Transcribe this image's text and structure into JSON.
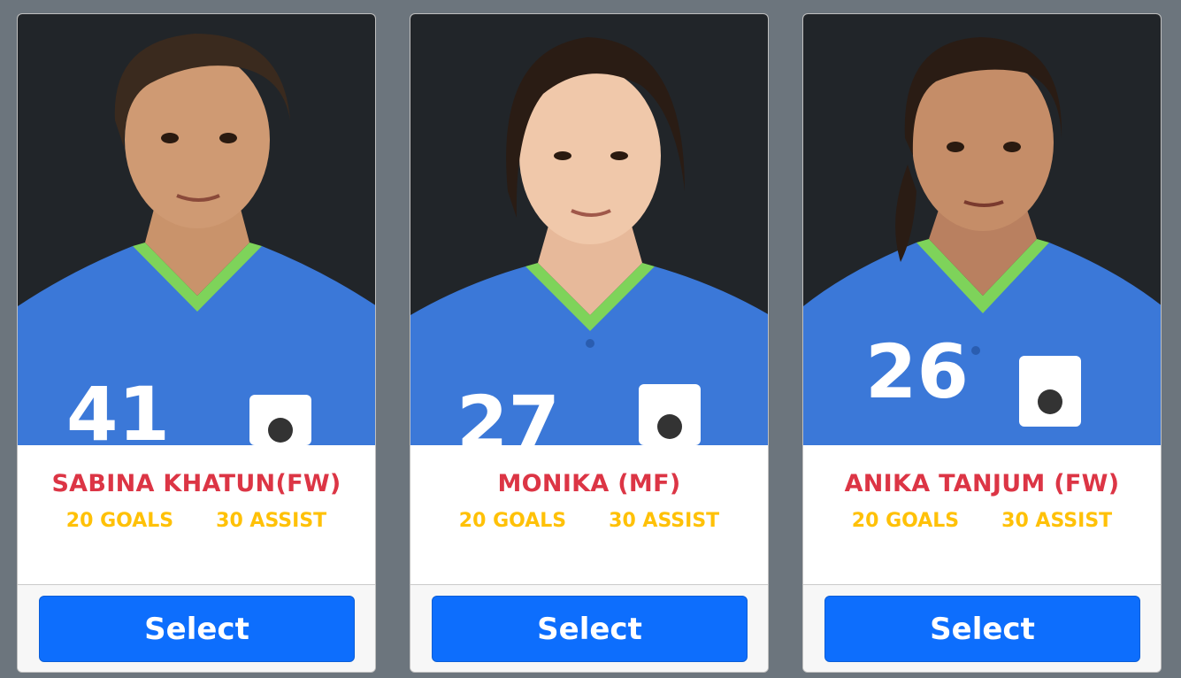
{
  "colors": {
    "page_background": "#6c757d",
    "photo_background": "#212529",
    "name_color": "#dc3545",
    "stats_color": "#ffc107",
    "button_color": "#0d6efd",
    "jersey_color": "#3b78d8",
    "collar_color": "#7ed35a"
  },
  "players": [
    {
      "name": "SABINA KHATUN(FW)",
      "goals": "20 GOALS",
      "assist": "30 ASSIST",
      "jersey_number": "41",
      "button_label": "Select",
      "photo": "player-photo"
    },
    {
      "name": "MONIKA (MF)",
      "goals": "20 GOALS",
      "assist": "30 ASSIST",
      "jersey_number": "27",
      "button_label": "Select",
      "photo": "player-photo"
    },
    {
      "name": "ANIKA TANJUM (FW)",
      "goals": "20 GOALS",
      "assist": "30 ASSIST",
      "jersey_number": "26",
      "button_label": "Select",
      "photo": "player-photo"
    }
  ]
}
